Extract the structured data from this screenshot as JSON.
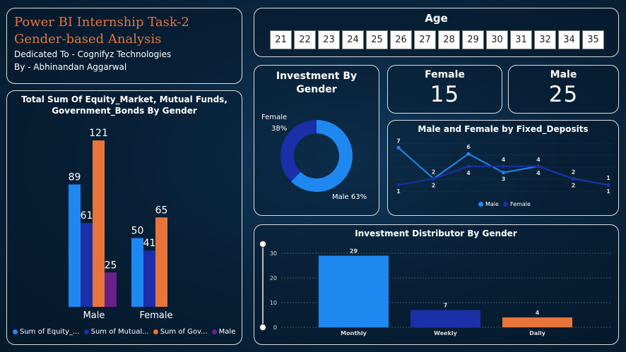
{
  "header": {
    "title_line1": "Power BI Internship Task-2",
    "title_line2": "Gender-based Analysis",
    "dedication": "Dedicated To - Cognifyz Technologies",
    "author": "By - Abhinandan Aggarwal"
  },
  "age_slicer": {
    "title": "Age",
    "options": [
      "21",
      "22",
      "23",
      "24",
      "25",
      "26",
      "27",
      "28",
      "29",
      "30",
      "31",
      "32",
      "34",
      "35"
    ]
  },
  "kpis": {
    "female": {
      "label": "Female",
      "value": "15"
    },
    "male": {
      "label": "Male",
      "value": "25"
    }
  },
  "colors": {
    "blue": "#1e88f0",
    "navy": "#1a2fa8",
    "orange": "#e8743b",
    "purple": "#6b1f8a"
  },
  "chart_data": [
    {
      "id": "bar",
      "type": "bar",
      "title": "Total Sum Of Equity_Market, Mutual Funds, Government_Bonds By Gender",
      "categories": [
        "Male",
        "Female"
      ],
      "series": [
        {
          "name": "Sum of Equity_...",
          "values": [
            89,
            50
          ]
        },
        {
          "name": "Sum of Mutual...",
          "values": [
            61,
            41
          ]
        },
        {
          "name": "Sum of Gov...",
          "values": [
            121,
            65
          ]
        },
        {
          "name": "Male",
          "values": [
            25,
            null
          ]
        }
      ]
    },
    {
      "id": "donut",
      "type": "pie",
      "title": "Investment By Gender",
      "slices": [
        {
          "label": "Female",
          "value": 38,
          "text": "38%"
        },
        {
          "label": "Male",
          "value": 63,
          "text": "Male 63%"
        }
      ]
    },
    {
      "id": "line",
      "type": "line",
      "title": "Male and Female by Fixed_Deposits",
      "x": [
        1,
        2,
        3,
        4,
        5,
        6,
        7
      ],
      "series": [
        {
          "name": "Male",
          "values": [
            7,
            2,
            6,
            3,
            4,
            2,
            1
          ]
        },
        {
          "name": "Female",
          "values": [
            1,
            2,
            4,
            4,
            4,
            2,
            1
          ]
        }
      ],
      "legend": "bottom"
    },
    {
      "id": "dist",
      "type": "bar",
      "title": "Investment Distributor By Gender",
      "categories": [
        "Monthly",
        "Weekly",
        "Daily"
      ],
      "values": [
        29,
        7,
        4
      ],
      "yticks": [
        "0",
        "10",
        "20",
        "30"
      ],
      "ylim": [
        0,
        30
      ],
      "grid": true
    }
  ]
}
